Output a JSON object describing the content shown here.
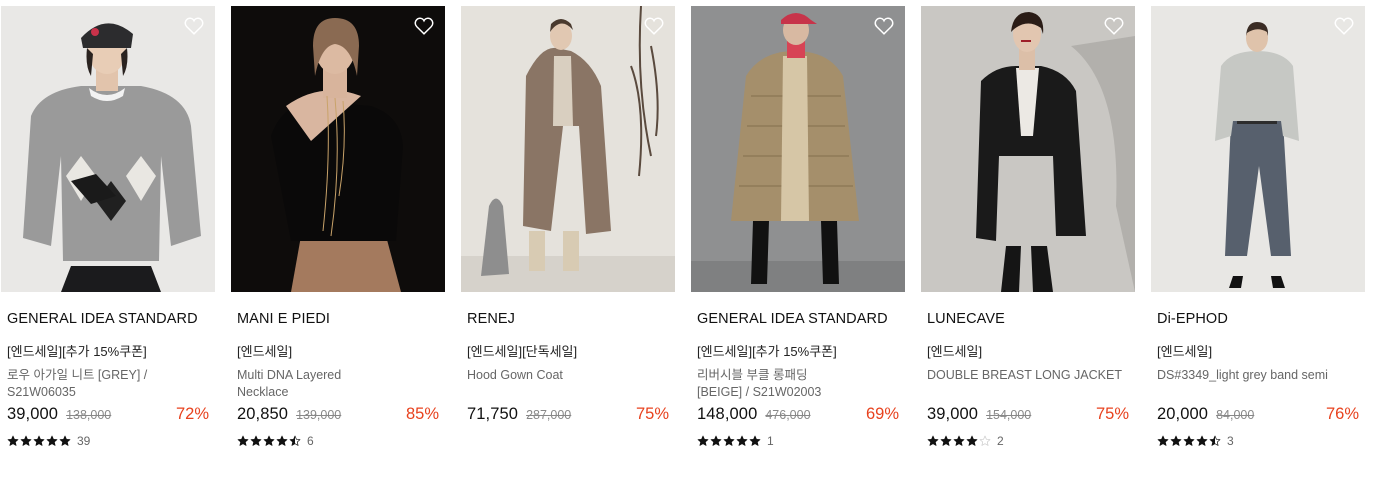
{
  "products": [
    {
      "brand": "GENERAL IDEA STANDARD",
      "tags": "[엔드세일][추가 15%쿠폰]",
      "name": "로우 아가일 니트 [GREY] / S21W06035",
      "price": "39,000",
      "original_price": "138,000",
      "discount": "72%",
      "rating": 5,
      "review_count": "39",
      "image": "model-grey-argyle-knit",
      "bg": "#e9e8e6"
    },
    {
      "brand": "MANI E PIEDI",
      "tags": "[엔드세일]",
      "name": "Multi DNA Layered Necklace",
      "price": "20,850",
      "original_price": "139,000",
      "discount": "85%",
      "rating": 4.5,
      "review_count": "6",
      "image": "model-black-top-necklace",
      "bg": "#0e0c0b"
    },
    {
      "brand": "RENEJ",
      "tags": "[엔드세일][단독세일]",
      "name": "Hood Gown Coat",
      "price": "71,750",
      "original_price": "287,000",
      "discount": "75%",
      "rating": null,
      "review_count": "",
      "image": "model-brown-hood-gown-coat",
      "bg": "#e5e2dc"
    },
    {
      "brand": "GENERAL IDEA STANDARD",
      "tags": "[엔드세일][추가 15%쿠폰]",
      "name": "리버시블 부클 롱패딩 [BEIGE] / S21W02003",
      "price": "148,000",
      "original_price": "476,000",
      "discount": "69%",
      "rating": 5,
      "review_count": "1",
      "image": "model-beige-long-padding",
      "bg": "#8f9091"
    },
    {
      "brand": "LUNECAVE",
      "tags": "[엔드세일]",
      "name": "DOUBLE BREAST LONG JACKET",
      "price": "39,000",
      "original_price": "154,000",
      "discount": "75%",
      "rating": 4,
      "review_count": "2",
      "image": "model-black-double-breast-jacket",
      "bg": "#c9c7c3"
    },
    {
      "brand": "Di-EPHOD",
      "tags": "[엔드세일]",
      "name": "DS#3349_light grey band semi",
      "price": "20,000",
      "original_price": "84,000",
      "discount": "76%",
      "rating": 4.5,
      "review_count": "3",
      "image": "model-grey-knit-denim",
      "bg": "#e8e7e4"
    }
  ],
  "colors": {
    "discount": "#e8421e",
    "star": "#111111",
    "star_empty": "#cccccc"
  },
  "icons": {
    "wishlist": "heart-outline-icon",
    "rating": "star-icon"
  }
}
